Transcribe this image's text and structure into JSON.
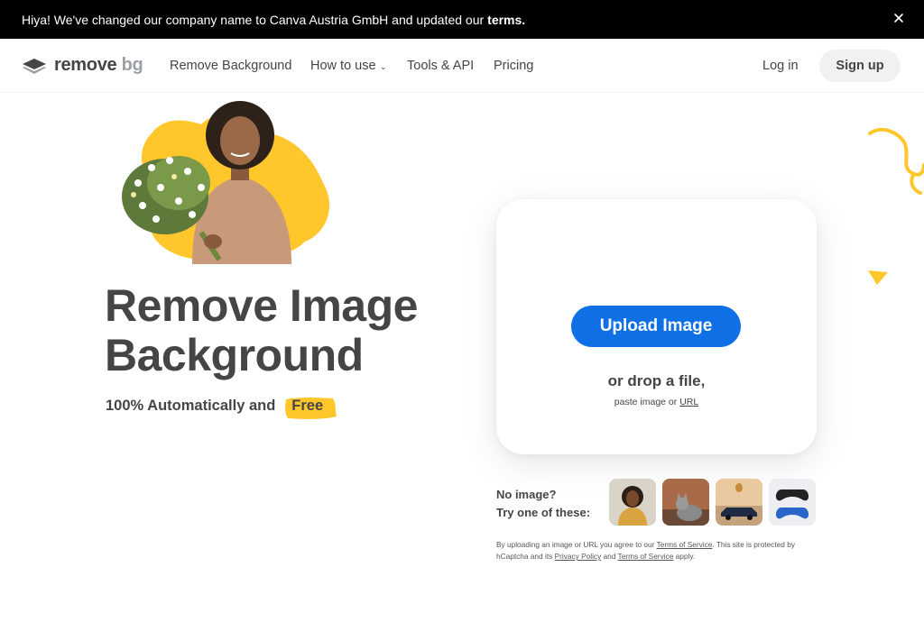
{
  "announcement": {
    "text": "Hiya! We've changed our company name to Canva Austria GmbH and updated our",
    "link": "terms."
  },
  "nav": {
    "logo_text": "remove",
    "logo_accent": "bg",
    "links": [
      "Remove Background",
      "How to use",
      "Tools & API",
      "Pricing"
    ],
    "login": "Log in",
    "signup": "Sign up"
  },
  "hero": {
    "title_line1": "Remove Image",
    "title_line2": "Background",
    "subtitle": "100% Automatically and",
    "free_badge": "Free"
  },
  "upload": {
    "button": "Upload Image",
    "drop_text": "or drop a file,",
    "paste_text": "paste image or",
    "url_link": "URL"
  },
  "samples": {
    "line1": "No image?",
    "line2": "Try one of these:",
    "items": [
      "woman-photo",
      "cat-photo",
      "car-photo",
      "gamepad-photo"
    ]
  },
  "legal": {
    "t1": "By uploading an image or URL you agree to our",
    "tos": "Terms of Service",
    "t2": ". This site is protected by hCaptcha and its",
    "privacy": "Privacy Policy",
    "t3": "and",
    "tos2": "Terms of Service",
    "t4": "apply."
  },
  "colors": {
    "accent_blue": "#0f70e6",
    "accent_yellow": "#ffc72c",
    "text": "#454545"
  }
}
